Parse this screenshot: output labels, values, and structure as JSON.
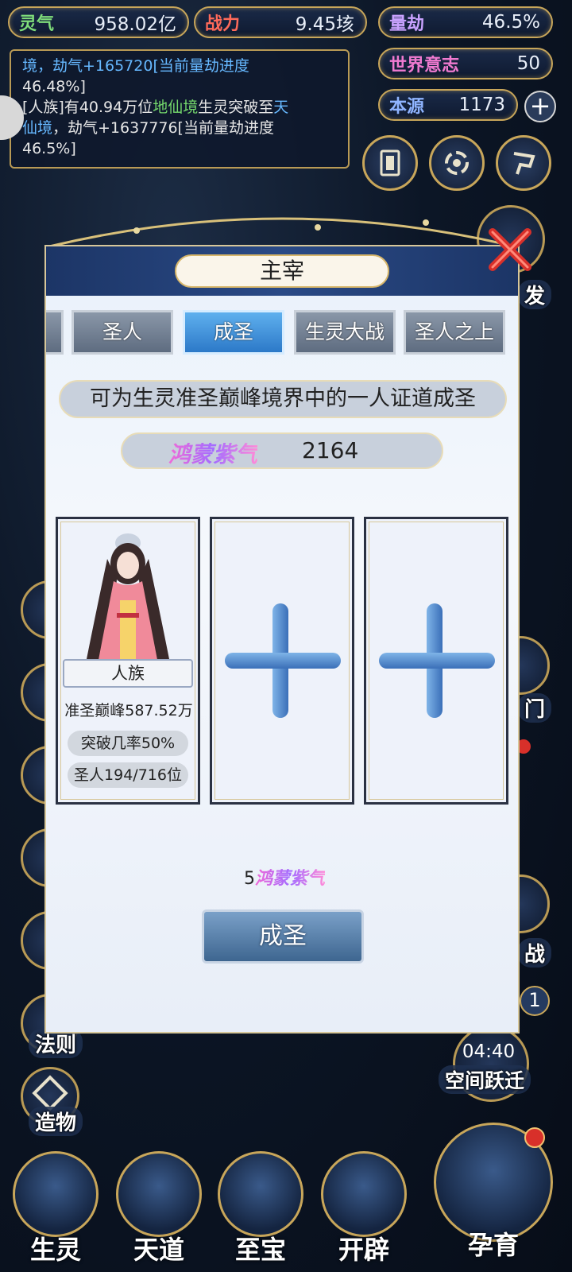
{
  "top_stats": {
    "lingqi": {
      "label": "灵气",
      "value": "958.02亿"
    },
    "zhanli": {
      "label": "战力",
      "value": "9.45垓"
    },
    "liangjie": {
      "label": "量劫",
      "value": "46.5%"
    },
    "shijie_yizhi": {
      "label": "世界意志",
      "value": "50"
    },
    "benyuan": {
      "label": "本源",
      "value": "1173"
    }
  },
  "log": {
    "line1_a": "境，劫气+165720[当前量劫进度",
    "line1_b": "46.48%]",
    "line2_prefix": "[人族]有40.94万位",
    "line2_realm1": "地仙境",
    "line2_mid": "生灵突破至",
    "line2_realm2a": "天",
    "line2_realm2b": "仙境",
    "line2_suffix": "，劫气+1637776[当前量劫进度",
    "line3": "46.5%]"
  },
  "side_labels": {
    "fa": "发",
    "men": "门",
    "zhan": "战",
    "fazhe": "法则",
    "zaowu": "造物",
    "badge": "1"
  },
  "timer": {
    "time": "04:40",
    "label": "空间跃迁"
  },
  "bottom_nav": [
    "生灵",
    "天道",
    "至宝",
    "开辟",
    "孕育"
  ],
  "modal": {
    "title": "主宰",
    "tabs": [
      "圣人",
      "成圣",
      "生灵大战",
      "圣人之上"
    ],
    "active_tab": "成圣",
    "description": "可为生灵准圣巅峰境界中的一人证道成圣",
    "currency": {
      "name": "鸿蒙紫气",
      "amount": "2164"
    },
    "candidate": {
      "race": "人族",
      "realm": "准圣巅峰587.52万",
      "rate": "突破几率50%",
      "saints": "圣人194/716位"
    },
    "cost": {
      "amount": "5",
      "name": "鸿蒙紫气"
    },
    "confirm_label": "成圣"
  },
  "colors": {
    "gold_border": "#c8a65a",
    "active_tab": "#2c79c8",
    "accent_purple": "#a46cff"
  }
}
